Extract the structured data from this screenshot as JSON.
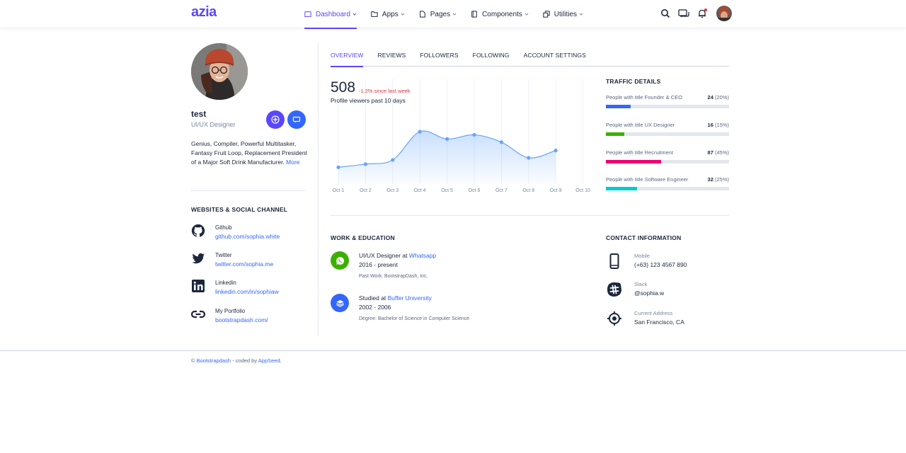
{
  "header": {
    "logo": "azia",
    "nav": [
      {
        "label": "Dashboard",
        "icon": "dashboard-icon",
        "active": true
      },
      {
        "label": "Apps",
        "icon": "folder-icon"
      },
      {
        "label": "Pages",
        "icon": "file-icon"
      },
      {
        "label": "Components",
        "icon": "box-icon"
      },
      {
        "label": "Utilities",
        "icon": "layers-icon"
      }
    ]
  },
  "profile": {
    "name": "test",
    "role": "UI/UX Designer",
    "bio": "Genius, Compiler, Powerful Multitasker, Fantasy Fruit Loop, Replacement President of a Major Soft Drink Manufacturer. ",
    "bio_more": "More"
  },
  "social": {
    "title": "WEBSITES & SOCIAL CHANNEL",
    "items": [
      {
        "label": "Github",
        "link": "github.com/sophia.white",
        "icon": "github-icon"
      },
      {
        "label": "Twitter",
        "link": "twitter.com/sophia.me",
        "icon": "twitter-icon"
      },
      {
        "label": "Linkedin",
        "link": "linkedin.com/in/sophiaw",
        "icon": "linkedin-icon"
      },
      {
        "label": "My Portfolio",
        "link": "bootstrapdash.com/",
        "icon": "link-icon"
      }
    ]
  },
  "tabs": [
    "OVERVIEW",
    "REVIEWS",
    "FOLLOWERS",
    "FOLLOWING",
    "ACCOUNT SETTINGS"
  ],
  "overview": {
    "value": "508",
    "delta": "-1.2% since last week",
    "subtitle": "Profile viewers past 10 days"
  },
  "chart_data": {
    "type": "area",
    "categories": [
      "Oct 1",
      "Oct 2",
      "Oct 3",
      "Oct 4",
      "Oct 5",
      "Oct 6",
      "Oct 7",
      "Oct 8",
      "Oct 9",
      "Oct 10"
    ],
    "values": [
      16,
      19,
      23,
      50,
      43,
      47,
      40,
      25,
      32,
      null
    ],
    "ylim": [
      0,
      100
    ],
    "color": "#66a4fb"
  },
  "traffic": {
    "title": "TRAFFIC DETAILS",
    "items": [
      {
        "label": "People with title Founder & CEO",
        "count": "24",
        "pct": "(20%)",
        "fraction": 0.2,
        "color": "#3366ff"
      },
      {
        "label": "People with title UX Designer",
        "count": "16",
        "pct": "(15%)",
        "fraction": 0.15,
        "color": "#3bb001"
      },
      {
        "label": "People with title Recruitment",
        "count": "87",
        "pct": "(45%)",
        "fraction": 0.45,
        "color": "#f10075"
      },
      {
        "label": "People with title Software Engineer",
        "count": "32",
        "pct": "(25%)",
        "fraction": 0.25,
        "color": "#00cccc"
      }
    ]
  },
  "work": {
    "title": "WORK & EDUCATION",
    "items": [
      {
        "title": "UI/UX Designer at ",
        "org": "Whatsapp",
        "years": "2016 - present",
        "detail": "Past Work: BootstrapDash, Inc.",
        "color": "#3bb001",
        "icon": "whatsapp-icon"
      },
      {
        "title": "Studied at ",
        "org": "Buffer University",
        "years": "2002 - 2006",
        "detail": "Degree: Bachelor of Science in Computer Science",
        "color": "#3366ff",
        "icon": "layers-icon"
      }
    ]
  },
  "contact": {
    "title": "CONTACT INFORMATION",
    "items": [
      {
        "label": "Mobile",
        "value": "(+63) 123 4567 890",
        "icon": "phone-icon"
      },
      {
        "label": "Slack",
        "value": "@sophia.w",
        "icon": "slack-icon"
      },
      {
        "label": "Current Address",
        "value": "San Francisco, CA",
        "icon": "location-icon"
      }
    ]
  },
  "footer": {
    "copyright": "© ",
    "brand": "Bootstrapdash",
    "mid": " - coded by ",
    "coder": "AppSeed",
    "end": "."
  }
}
